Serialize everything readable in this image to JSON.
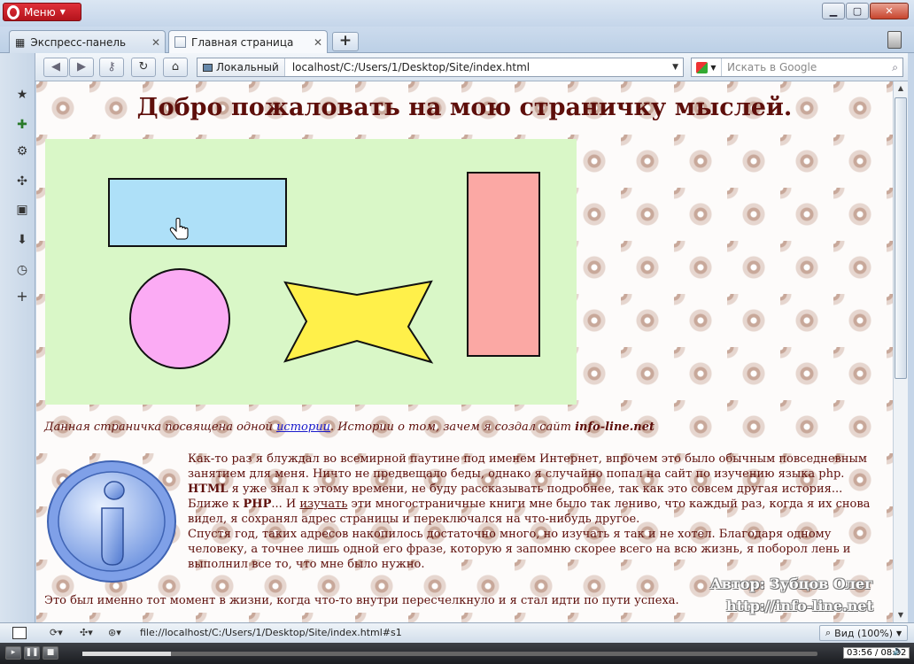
{
  "browser": {
    "menu_label": "Меню",
    "tabs": [
      {
        "label": "Экспресс-панель"
      },
      {
        "label": "Главная страница"
      }
    ],
    "newtab_label": "+",
    "address": {
      "site_label": "Локальный",
      "url": "localhost/C:/Users/1/Desktop/Site/index.html"
    },
    "search": {
      "placeholder": "Искать в Google"
    },
    "status": {
      "link_url": "file://localhost/C:/Users/1/Desktop/Site/index.html#s1",
      "zoom": "Вид (100%)"
    },
    "media": {
      "time": "03:56 / 08:02",
      "progress": 0.12
    }
  },
  "page": {
    "title": "Добро пожаловать на мою страничку мыслей.",
    "shapes": {
      "rect_color": "#aee0f8",
      "circle_color": "#fbabf4",
      "bowtie_color": "#fff04a",
      "tall_rect_color": "#fba8a4",
      "bg_color": "#d9f7c7"
    },
    "intro": {
      "before": "Данная страничка посвящена одной ",
      "link": "истории",
      "middle": ". Истории о том, зачем я создал сайт ",
      "site": "info-line.net"
    },
    "story": {
      "p1_before": "Как-то раз я блуждал во всемирной паутине под именем Интернет, впрочем это было обычным повседневным занятием для меня. Ничто не предвещало беды, однако я случайно попал на сайт по изучению языка php. ",
      "p1_html": "HTML",
      "p1_after": " я уже знал к этому времени, не буду рассказывать подробнее, так как это совсем другая история...",
      "p2_before": "Ближе к ",
      "p2_php": "PHP",
      "p2_mid": "... И ",
      "p2_link": "изучать",
      "p2_after": " эти многостраничные книги мне было так лениво, что каждый раз, когда я их снова видел, я сохранял адрес страницы и переключался на что-нибудь другое.",
      "p3": "Спустя год, таких адресов накопилось достаточно много, но изучать я так и не хотел. Благодаря одному человеку, а точнее лишь одной его фразе, которую я запомню скорее всего на всю жизнь, я поборол лень и выполнил все то, что мне было нужно."
    },
    "final": "Это был именно тот момент в жизни, когда что-то внутри пересчелкнуло и я стал идти по пути успеха.",
    "author": {
      "line1": "Автор: Зубцов Олег",
      "line2": "http://info-line.net"
    }
  }
}
